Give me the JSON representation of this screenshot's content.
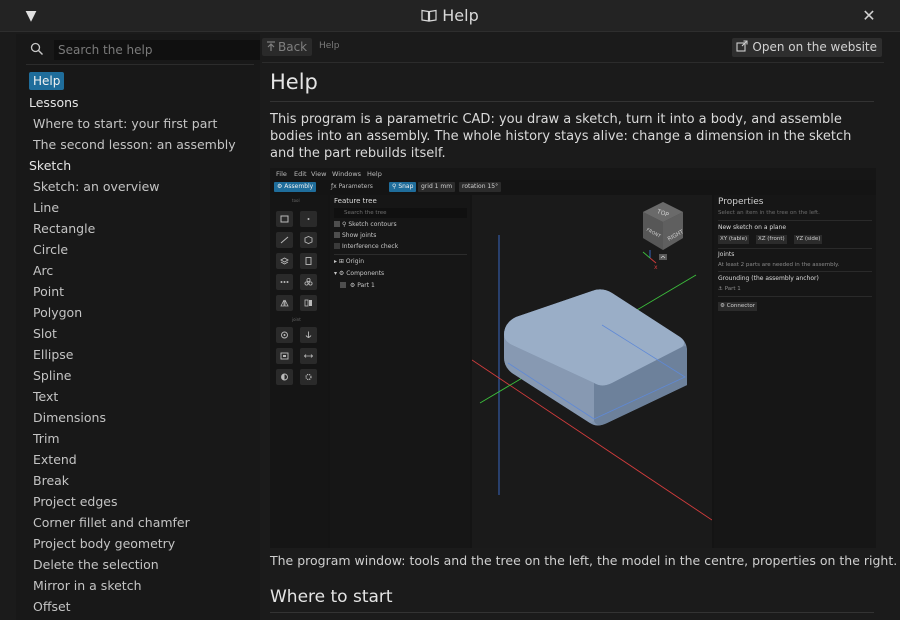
{
  "window": {
    "title": "Help",
    "collapse_icon": "triangle-down-icon",
    "close_icon": "close-icon"
  },
  "sidebar": {
    "search_placeholder": "Search the help",
    "active_item": "Help",
    "sections": [
      {
        "title": "Lessons",
        "items": [
          "Where to start: your first part",
          "The second lesson: an assembly"
        ]
      },
      {
        "title": "Sketch",
        "items": [
          "Sketch: an overview",
          "Line",
          "Rectangle",
          "Circle",
          "Arc",
          "Point",
          "Polygon",
          "Slot",
          "Ellipse",
          "Spline",
          "Text",
          "Dimensions",
          "Trim",
          "Extend",
          "Break",
          "Project edges",
          "Corner fillet and chamfer",
          "Project body geometry",
          "Delete the selection",
          "Mirror in a sketch",
          "Offset"
        ]
      }
    ]
  },
  "topbar": {
    "back_label": "Back",
    "breadcrumb": "Help",
    "website_label": "Open on the website"
  },
  "article": {
    "title": "Help",
    "intro": "This program is a parametric CAD: you draw a sketch, turn it into a body, and assemble bodies into an assembly. The whole history stays alive: change a dimension in the sketch and the part rebuilds itself.",
    "caption": "The program window: tools and the tree on the left, the model in the centre, properties on the right.",
    "next_heading": "Where to start"
  },
  "figure": {
    "menus": [
      "File",
      "Edit",
      "View",
      "Windows",
      "Help"
    ],
    "toolbar": {
      "assembly": "Assembly",
      "parameters": "Parameters",
      "snap": "Snap",
      "grid": "grid 1 mm",
      "rotation": "rotation 15°"
    },
    "tools_label": "tool",
    "joints_label": "joint",
    "tree": {
      "title": "Feature tree",
      "search_placeholder": "Search the tree",
      "checks": [
        "Sketch contours",
        "Show joints",
        "Interference check"
      ],
      "nodes": [
        "Origin",
        "Components",
        "Part 1"
      ]
    },
    "viewcube": {
      "top": "TOP",
      "front": "FRONT",
      "right": "RIGHT"
    },
    "properties": {
      "title": "Properties",
      "placeholder": "Select an item in the tree on the left.",
      "new_sketch_label": "New sketch on a plane",
      "planes": [
        "XY (table)",
        "XZ (front)",
        "YZ (side)"
      ],
      "joints_label": "Joints",
      "joints_hint": "At least 2 parts are needed in the assembly.",
      "grounding_label": "Grounding (the assembly anchor)",
      "grounding_value": "Part 1",
      "connector_label": "Connector"
    },
    "colors": {
      "accent": "#1f6d9b",
      "body": "#8fa4bf",
      "axis_red": "#d23c3c",
      "axis_green": "#3cbf3c",
      "axis_blue": "#3c6ed2"
    }
  }
}
